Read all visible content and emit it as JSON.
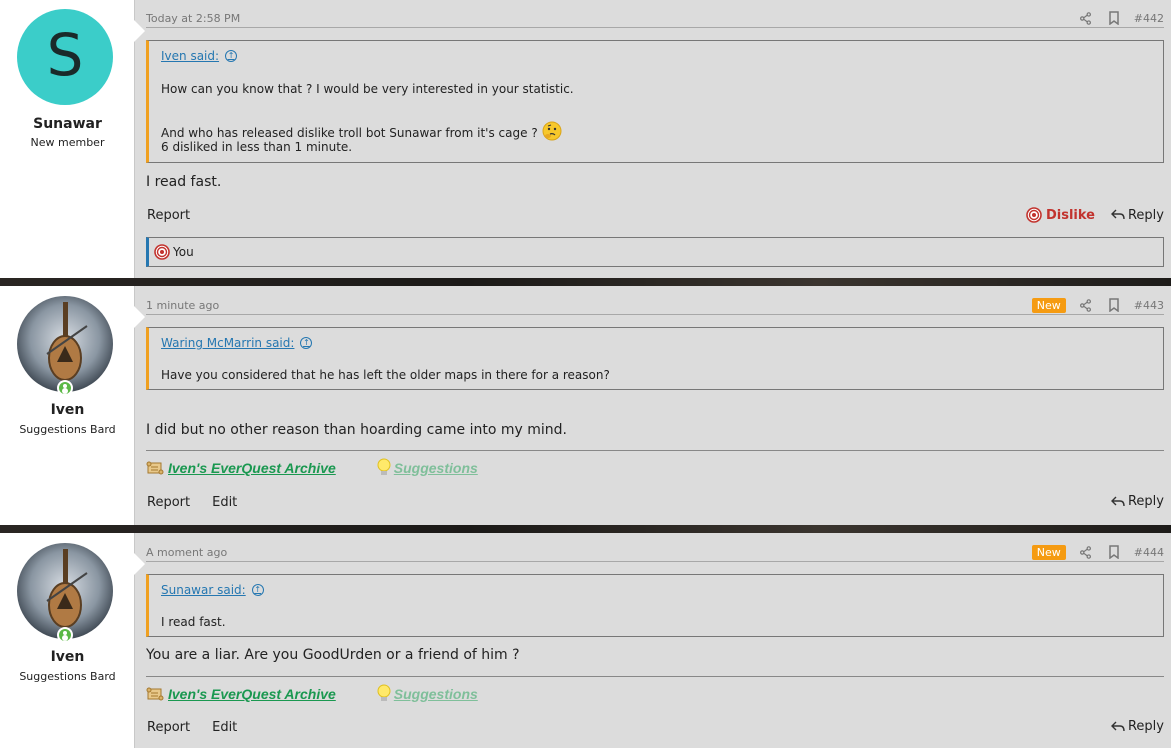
{
  "posts": [
    {
      "author": "Sunawar",
      "author_title": "New member",
      "avatar_letter": "S",
      "time": "Today at 2:58 PM",
      "number": "#442",
      "quote": {
        "author_label": "Iven said:",
        "lines": [
          "How can you know that ? I would be very interested in your statistic.",
          "And who has released dislike troll bot Sunawar from it's cage ?",
          "6 disliked in less than 1 minute."
        ]
      },
      "message": "I read fast.",
      "actions_left": [
        "Report"
      ],
      "reaction_label": "Dislike",
      "reply_label": "Reply",
      "reacted_by": "You"
    },
    {
      "author": "Iven",
      "author_title": "Suggestions Bard",
      "time": "1 minute ago",
      "badge": "New",
      "number": "#443",
      "quote": {
        "author_label": "Waring McMarrin said:",
        "lines": [
          "Have you considered that he has left the older maps in there for a reason?"
        ]
      },
      "message": "I did but no other reason than hoarding came into my mind.",
      "signature": [
        "Iven's EverQuest Archive",
        "Suggestions"
      ],
      "actions_left": [
        "Report",
        "Edit"
      ],
      "reply_label": "Reply"
    },
    {
      "author": "Iven",
      "author_title": "Suggestions Bard",
      "time": "A moment ago",
      "badge": "New",
      "number": "#444",
      "quote": {
        "author_label": "Sunawar said:",
        "lines": [
          "I read fast."
        ]
      },
      "message": "You are a liar. Are you GoodUrden or a friend of him ?",
      "signature": [
        "Iven's EverQuest Archive",
        "Suggestions"
      ],
      "actions_left": [
        "Report",
        "Edit"
      ],
      "reply_label": "Reply"
    }
  ],
  "colors": {
    "online": "#5ab845",
    "new_badge": "#f59b12",
    "link": "#2577b1",
    "dislike": "#c2332e",
    "avatar_bg": "#3bcdc9",
    "sig_link": "#1a9850"
  },
  "icons": [
    "share-icon",
    "bookmark-icon",
    "arrow-up-circle-icon",
    "target-icon",
    "reply-icon",
    "scroll-icon",
    "lightbulb-icon",
    "thinking-emoji-icon"
  ]
}
